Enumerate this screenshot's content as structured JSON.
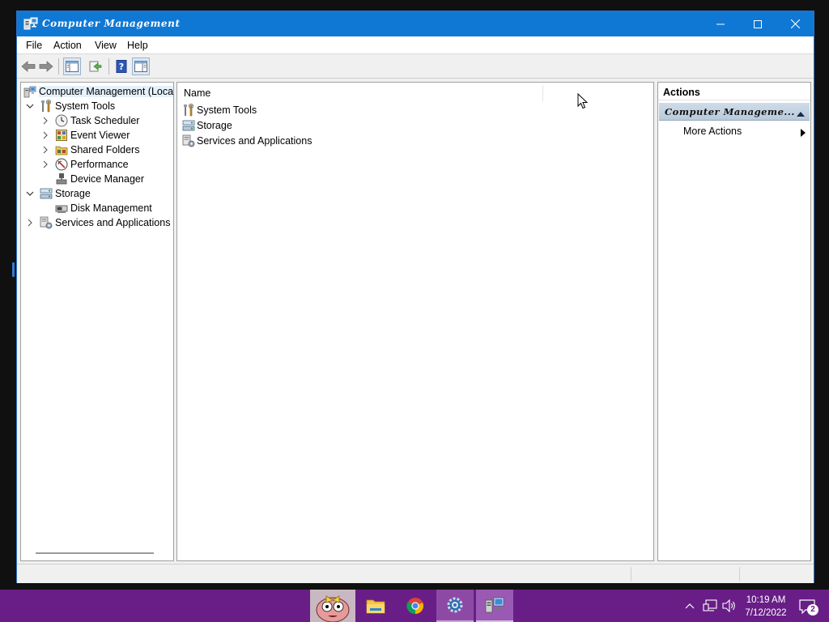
{
  "window": {
    "title": "Computer Management",
    "title_icon": "computer-management-icon",
    "controls": [
      "minimize",
      "maximize",
      "close"
    ]
  },
  "menu": {
    "items": [
      {
        "label": "File"
      },
      {
        "label": "Action"
      },
      {
        "label": "View"
      },
      {
        "label": "Help"
      }
    ]
  },
  "toolbar": {
    "buttons": [
      "back-arrow-icon",
      "forward-arrow-icon",
      "show-hide-console-tree-icon",
      "export-list-icon",
      "help-icon",
      "show-hide-action-pane-icon"
    ]
  },
  "tree": {
    "root": {
      "label": "Computer Management (Local",
      "icon": "computer-management-icon"
    },
    "items": [
      {
        "label": "System Tools",
        "icon": "tools-icon",
        "expander": "expanded"
      },
      {
        "label": "Task Scheduler",
        "icon": "clock-icon",
        "expander": "collapsed"
      },
      {
        "label": "Event Viewer",
        "icon": "event-viewer-icon",
        "expander": "collapsed"
      },
      {
        "label": "Shared Folders",
        "icon": "shared-folders-icon",
        "expander": "collapsed"
      },
      {
        "label": "Performance",
        "icon": "performance-icon",
        "expander": "collapsed"
      },
      {
        "label": "Device Manager",
        "icon": "device-manager-icon",
        "expander": "none"
      },
      {
        "label": "Storage",
        "icon": "storage-icon",
        "expander": "expanded"
      },
      {
        "label": "Disk Management",
        "icon": "disk-management-icon",
        "expander": "none"
      },
      {
        "label": "Services and Applications",
        "icon": "services-icon",
        "expander": "collapsed"
      }
    ]
  },
  "list": {
    "column_name": "Name",
    "rows": [
      {
        "label": "System Tools",
        "icon": "tools-icon"
      },
      {
        "label": "Storage",
        "icon": "storage-icon"
      },
      {
        "label": "Services and Applications",
        "icon": "services-icon"
      }
    ]
  },
  "actions": {
    "title": "Actions",
    "section": "Computer Manageme...",
    "item": "More Actions"
  },
  "taskbar": {
    "apps": [
      "pinned-image-app-icon",
      "file-explorer-icon",
      "chrome-icon",
      "settings-gear-icon",
      "computer-management-icon"
    ],
    "clock_time": "10:19 AM",
    "clock_date": "7/12/2022",
    "notification_count": "2"
  },
  "colors": {
    "titlebar": "#0f78d4",
    "taskbar": "#681e86",
    "selection": "#e5f1fb"
  }
}
